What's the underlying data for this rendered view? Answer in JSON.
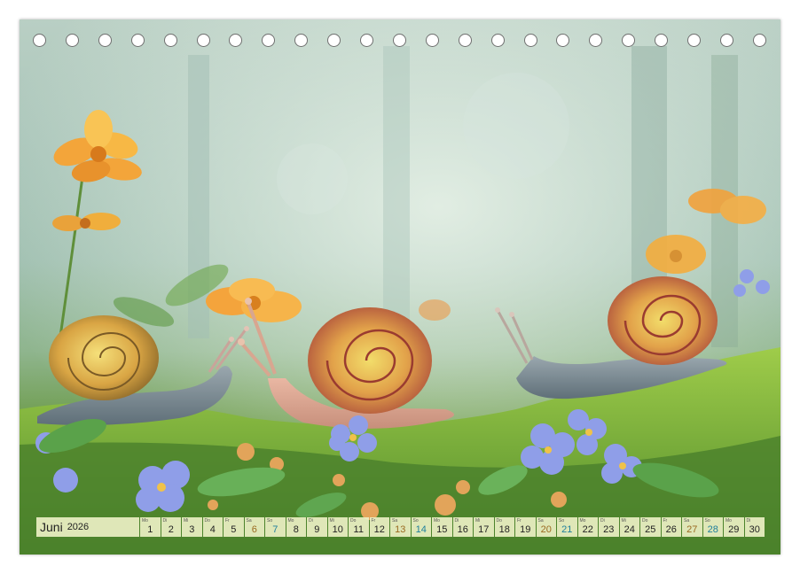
{
  "calendar": {
    "month": "Juni",
    "year": "2026",
    "days": [
      {
        "wd": "Mo",
        "n": "1",
        "type": "weekday"
      },
      {
        "wd": "Di",
        "n": "2",
        "type": "weekday"
      },
      {
        "wd": "Mi",
        "n": "3",
        "type": "weekday"
      },
      {
        "wd": "Do",
        "n": "4",
        "type": "weekday"
      },
      {
        "wd": "Fr",
        "n": "5",
        "type": "weekday"
      },
      {
        "wd": "Sa",
        "n": "6",
        "type": "sat"
      },
      {
        "wd": "So",
        "n": "7",
        "type": "sun"
      },
      {
        "wd": "Mo",
        "n": "8",
        "type": "weekday"
      },
      {
        "wd": "Di",
        "n": "9",
        "type": "weekday"
      },
      {
        "wd": "Mi",
        "n": "10",
        "type": "weekday"
      },
      {
        "wd": "Do",
        "n": "11",
        "type": "weekday"
      },
      {
        "wd": "Fr",
        "n": "12",
        "type": "weekday"
      },
      {
        "wd": "Sa",
        "n": "13",
        "type": "sat"
      },
      {
        "wd": "So",
        "n": "14",
        "type": "sun"
      },
      {
        "wd": "Mo",
        "n": "15",
        "type": "weekday"
      },
      {
        "wd": "Di",
        "n": "16",
        "type": "weekday"
      },
      {
        "wd": "Mi",
        "n": "17",
        "type": "weekday"
      },
      {
        "wd": "Do",
        "n": "18",
        "type": "weekday"
      },
      {
        "wd": "Fr",
        "n": "19",
        "type": "weekday"
      },
      {
        "wd": "Sa",
        "n": "20",
        "type": "sat"
      },
      {
        "wd": "So",
        "n": "21",
        "type": "sun"
      },
      {
        "wd": "Mo",
        "n": "22",
        "type": "weekday"
      },
      {
        "wd": "Di",
        "n": "23",
        "type": "weekday"
      },
      {
        "wd": "Mi",
        "n": "24",
        "type": "weekday"
      },
      {
        "wd": "Do",
        "n": "25",
        "type": "weekday"
      },
      {
        "wd": "Fr",
        "n": "26",
        "type": "weekday"
      },
      {
        "wd": "Sa",
        "n": "27",
        "type": "sat"
      },
      {
        "wd": "So",
        "n": "28",
        "type": "sun"
      },
      {
        "wd": "Mo",
        "n": "29",
        "type": "weekday"
      },
      {
        "wd": "Di",
        "n": "30",
        "type": "weekday"
      }
    ]
  },
  "binding": {
    "hole_count": 23
  },
  "colors": {
    "saturday": "#9a6a20",
    "sunday": "#1f7f9c",
    "bar": "#ecf0c4"
  }
}
